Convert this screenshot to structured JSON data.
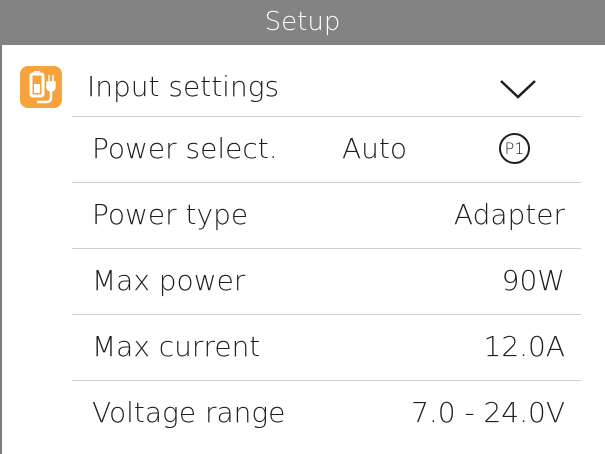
{
  "title": "Setup",
  "section": {
    "label": "Input settings",
    "icon": "power-adapter-icon",
    "expand_icon": "chevron-down-icon",
    "accent_color": "#f6a23d"
  },
  "rows": [
    {
      "label": "Power select.",
      "value": "Auto",
      "badge": "P1"
    },
    {
      "label": "Power type",
      "value": "Adapter"
    },
    {
      "label": "Max power",
      "value": "90W"
    },
    {
      "label": "Max current",
      "value": "12.0A"
    },
    {
      "label": "Voltage range",
      "value": "7.0 - 24.0V"
    }
  ]
}
